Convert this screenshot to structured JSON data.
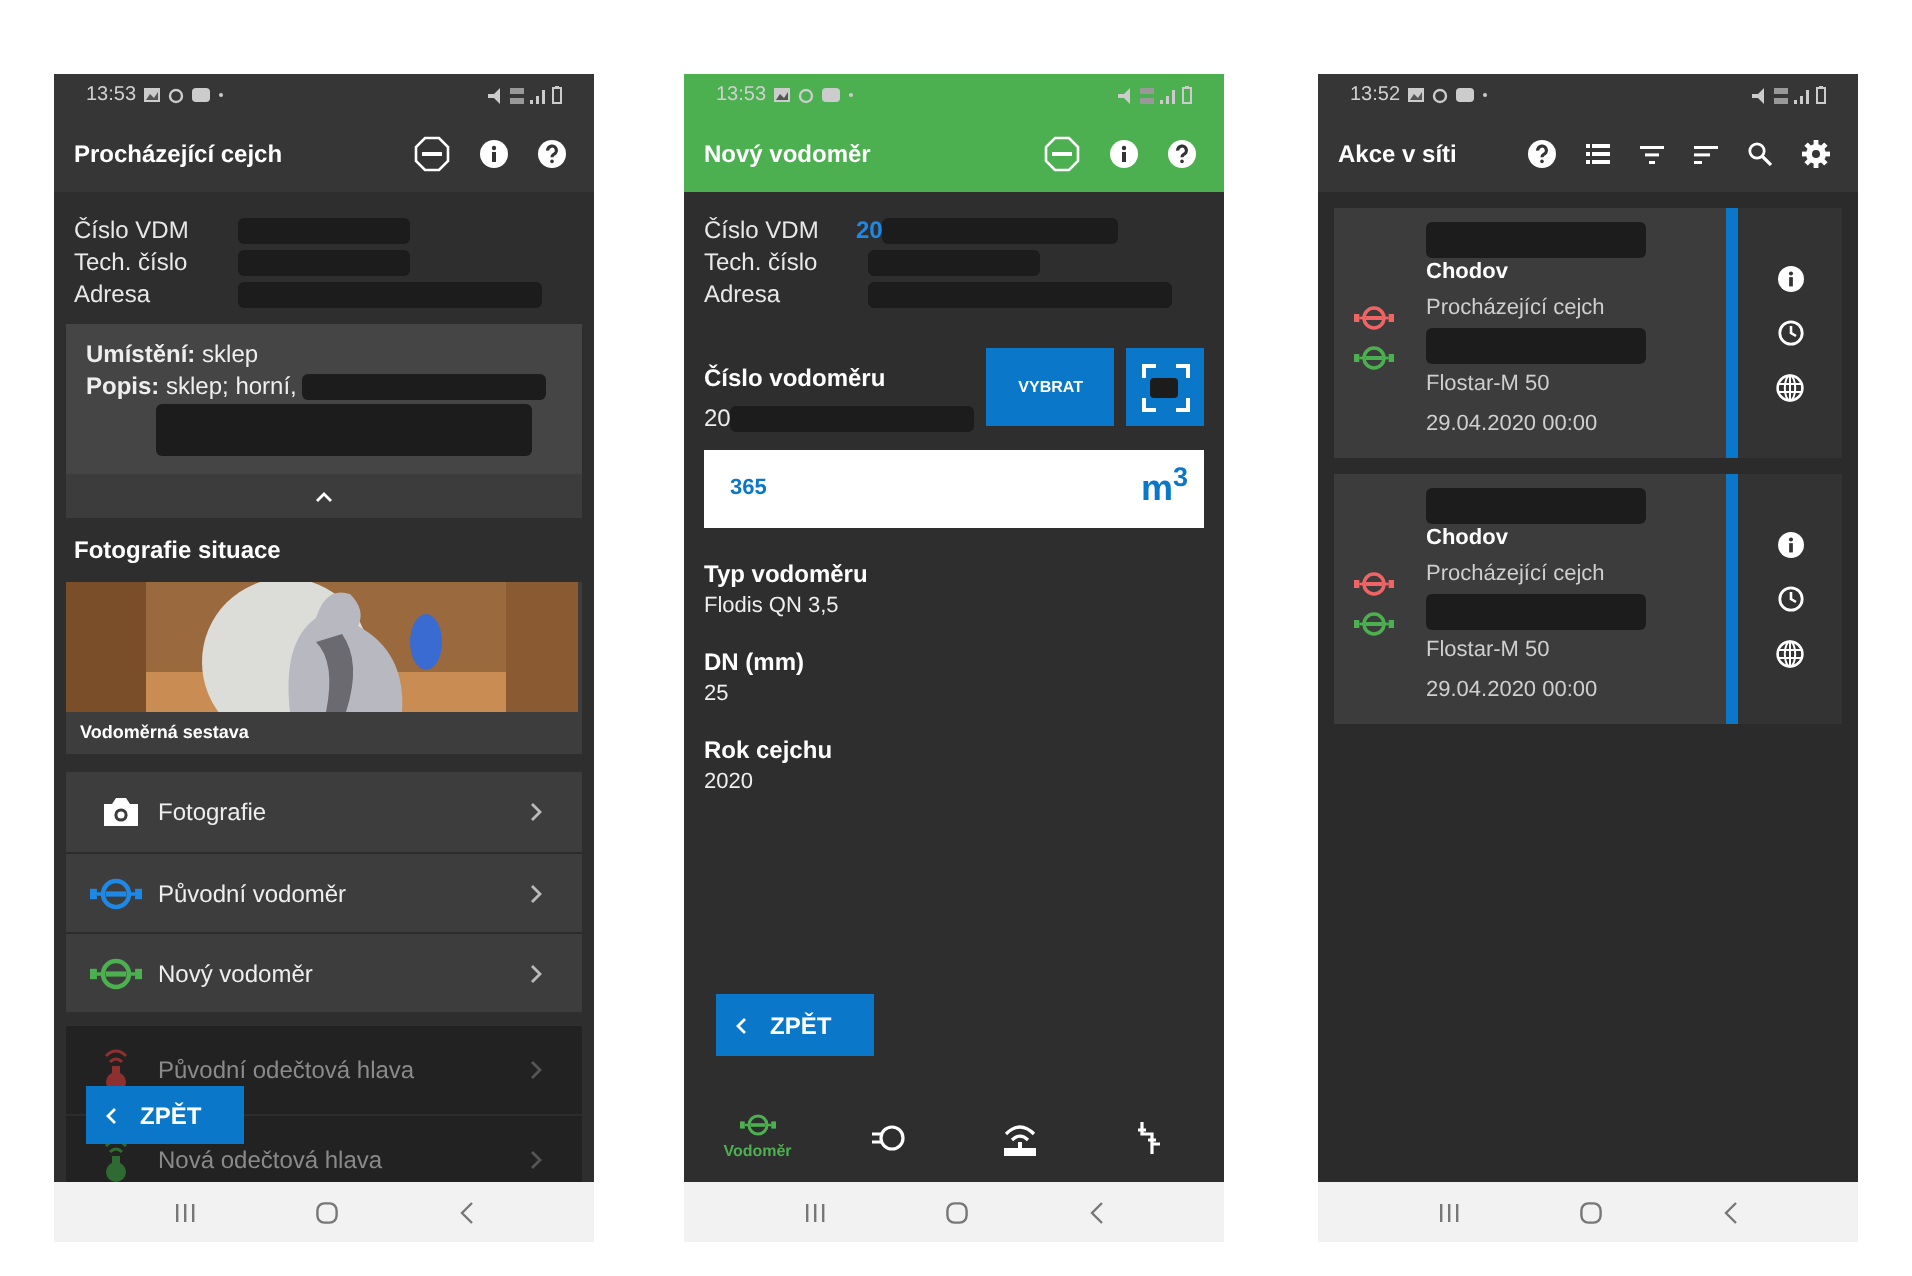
{
  "phones": [
    {
      "kind": "detail",
      "status_time": "13:53",
      "app_bar": {
        "title": "Procházející cejch",
        "color": "#363636"
      },
      "fields": [
        {
          "label": "Číslo VDM",
          "redacted": true
        },
        {
          "label": "Tech. číslo",
          "redacted": true
        },
        {
          "label": "Adresa",
          "redacted": true
        }
      ],
      "info_panel": {
        "location": "**Umístění:** sklep",
        "description": "**Popis:** sklep; horní,",
        "expanded": true
      },
      "section_title": "Fotografie situace",
      "photo_caption": "Vodoměrná sestava",
      "menu": [
        {
          "kind": "camera",
          "label": "Fotografie",
          "disabled": false
        },
        {
          "kind": "meter",
          "label": "Původní vodoměr",
          "color": "#1e88e5",
          "disabled": false
        },
        {
          "kind": "meter",
          "label": "Nový vodoměr",
          "color": "#4caf50",
          "disabled": false
        },
        {
          "kind": "head",
          "label": "Původní odečtová hlava",
          "color": "#8e3030",
          "disabled": true
        },
        {
          "kind": "head",
          "label": "Nová odečtová hlava",
          "color": "#2f6a33",
          "disabled": true
        }
      ],
      "back_button": "ZPĚT"
    },
    {
      "kind": "form",
      "status_time": "13:53",
      "app_bar": {
        "title": "Nový vodoměr",
        "color": "#4caf50"
      },
      "fields": [
        {
          "label": "Číslo VDM",
          "value": "20",
          "redacted": true
        },
        {
          "label": "Tech. číslo",
          "redacted": true
        },
        {
          "label": "Adresa",
          "redacted": true
        }
      ],
      "meter_number": {
        "label": "Číslo vodoměru",
        "value": "20",
        "redacted": true
      },
      "select_button": "VYBRAT",
      "reading": {
        "value": "365",
        "unit": "m$^{3}$"
      },
      "specs": [
        {
          "label": "Typ vodoměru",
          "value": "Flodis QN 3,5"
        },
        {
          "label": "DN (mm)",
          "value": "25"
        },
        {
          "label": "Rok cejchu",
          "value": "2020"
        }
      ],
      "back_button": "ZPĚT",
      "bottom_nav": [
        {
          "kind": "meter",
          "label": "Vodoměr",
          "selected": true
        },
        {
          "kind": "loop",
          "selected": false
        },
        {
          "kind": "radio",
          "selected": false
        },
        {
          "kind": "pipes",
          "selected": false
        }
      ]
    },
    {
      "kind": "list",
      "status_time": "13:52",
      "app_bar": {
        "title": "Akce v síti",
        "color": "#363636"
      },
      "cards": [
        {
          "city": "Chodov",
          "action": "Procházející cejch",
          "model": "Flostar-M 50",
          "date": "29.04.2020 00:00"
        },
        {
          "city": "Chodov",
          "action": "Procházející cejch",
          "model": "Flostar-M 50",
          "date": "29.04.2020 00:00"
        }
      ]
    }
  ]
}
